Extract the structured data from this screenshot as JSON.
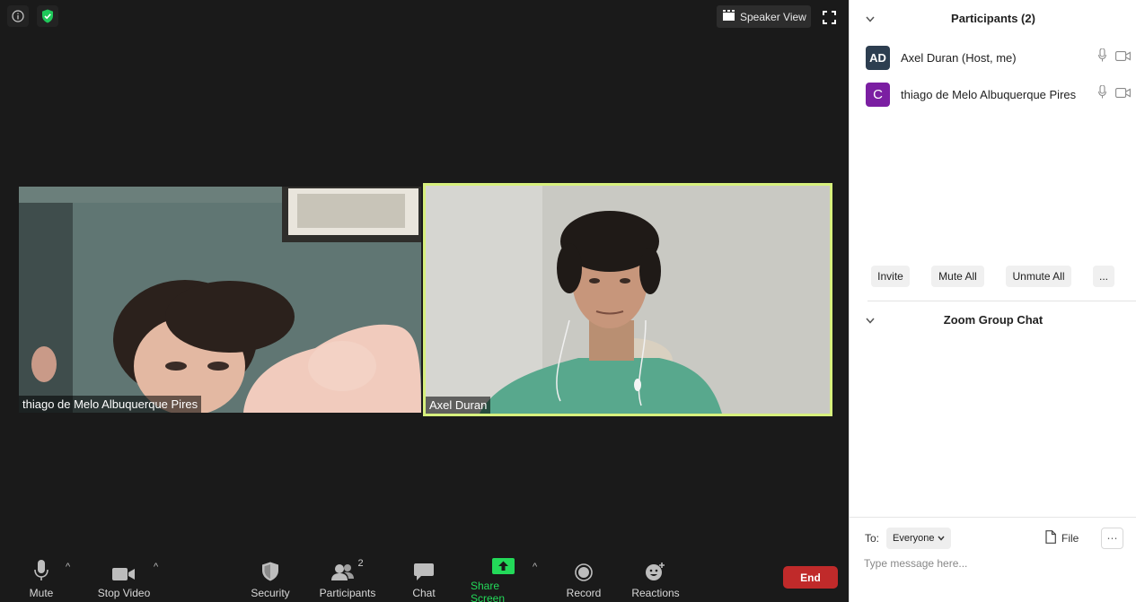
{
  "top_bar": {
    "view_label": "Speaker View"
  },
  "videos": [
    {
      "name": "thiago de Melo Albuquerque Pires"
    },
    {
      "name": "Axel Duran"
    }
  ],
  "toolbar": {
    "mute": "Mute",
    "stop_video": "Stop Video",
    "security": "Security",
    "participants": "Participants",
    "participants_count": "2",
    "chat": "Chat",
    "share_screen": "Share Screen",
    "record": "Record",
    "reactions": "Reactions",
    "end": "End"
  },
  "participants_panel": {
    "title": "Participants (2)",
    "list": [
      {
        "initials": "AD",
        "name": "Axel Duran (Host, me)",
        "avatar_color": "#2d3e50"
      },
      {
        "initials": "C",
        "name": "thiago de Melo Albuquerque Pires",
        "avatar_color": "#7b1fa2"
      }
    ],
    "buttons": {
      "invite": "Invite",
      "mute_all": "Mute All",
      "unmute_all": "Unmute All",
      "more": "..."
    }
  },
  "chat_panel": {
    "title": "Zoom Group Chat",
    "to_label": "To:",
    "recipient": "Everyone",
    "file_label": "File",
    "more": "⋯",
    "placeholder": "Type message here..."
  },
  "colors": {
    "active_speaker_border": "#d7f07d",
    "share_green": "#23d959",
    "end_red": "#c02a2a"
  }
}
